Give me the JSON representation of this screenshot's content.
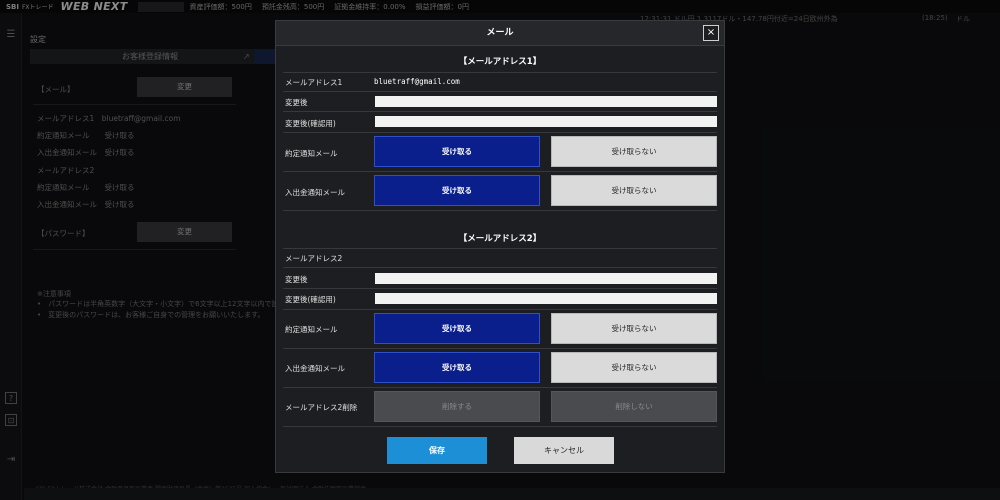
{
  "topbar": {
    "logo_sbi": "SBI",
    "logo_fx": "FXトレード",
    "logo_web": "WEB NEXT",
    "stats": [
      "資産評価額：500円",
      "預託金残高：500円",
      "証拠金維持率：0.00%",
      "損益評価額：0円"
    ]
  },
  "ticker": {
    "text": "12:31:31 ドル円 1.3117ドル・147.78円付近=24日欧州外為",
    "time": "(18:25)",
    "tail": "ドル"
  },
  "settings": {
    "title": "設定",
    "tab_label": "お客様登録情報",
    "mail_label": "【メール】",
    "change_label": "変更",
    "rows": [
      "メールアドレス1　bluetraff@gmail.com",
      "約定通知メール　　受け取る",
      "入出金通知メール　受け取る",
      "メールアドレス2",
      "約定通知メール　　受け取る",
      "入出金通知メール　受け取る"
    ],
    "password_label": "【パスワード】",
    "notes_title": "※注意事項",
    "notes": [
      "•　パスワードは半角英数字（大文字・小文字）で6文字以上12文字以内で設",
      "•　変更後のパスワードは、お客様ご自身での管理をお願いいたします。"
    ],
    "footer": "SBI FXトレード株式会社 金融商品取引業者 関東財務局長（金商）第2635号 加入協会：一般社団法人 金融先物取引業協会"
  },
  "modal": {
    "title": "メール",
    "close": "×",
    "section1": {
      "title": "【メールアドレス1】",
      "address_label": "メールアドレス1",
      "address_value": "bluetraff@gmail.com",
      "new_label": "変更後",
      "confirm_label": "変更後(確認用)",
      "trade_label": "約定通知メール",
      "deposit_label": "入出金通知メール"
    },
    "section2": {
      "title": "【メールアドレス2】",
      "address_label": "メールアドレス2",
      "new_label": "変更後",
      "confirm_label": "変更後(確認用)",
      "trade_label": "約定通知メール",
      "deposit_label": "入出金通知メール",
      "delete_label": "メールアドレス2削除"
    },
    "receive": "受け取る",
    "not_receive": "受け取らない",
    "delete": "削除する",
    "not_delete": "削除しない",
    "save": "保存",
    "cancel": "キャンセル"
  }
}
